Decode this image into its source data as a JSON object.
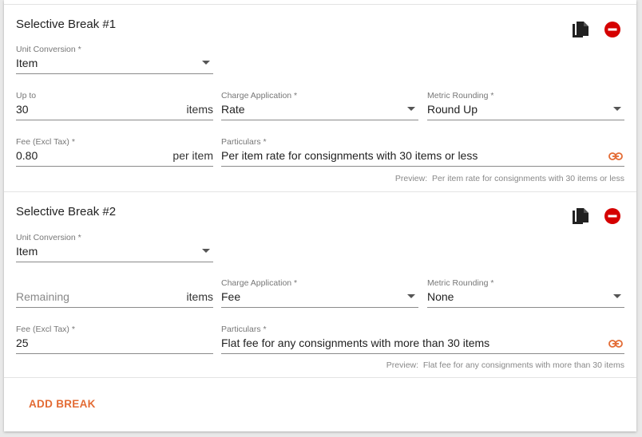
{
  "breaks": [
    {
      "title": "Selective Break #1",
      "unit_conversion": {
        "label": "Unit Conversion *",
        "value": "Item"
      },
      "range": {
        "label": "Up to",
        "value": "30",
        "suffix": "items"
      },
      "charge_application": {
        "label": "Charge Application *",
        "value": "Rate"
      },
      "metric_rounding": {
        "label": "Metric Rounding *",
        "value": "Round Up"
      },
      "fee": {
        "label": "Fee (Excl Tax) *",
        "value": "0.80",
        "suffix": "per item"
      },
      "particulars": {
        "label": "Particulars *",
        "value": "Per item rate for consignments with 30 items or less"
      },
      "preview_label": "Preview:",
      "preview_text": "Per item rate for consignments with 30 items or less"
    },
    {
      "title": "Selective Break #2",
      "unit_conversion": {
        "label": "Unit Conversion *",
        "value": "Item"
      },
      "range": {
        "label": "",
        "placeholder": "Remaining",
        "suffix": "items"
      },
      "charge_application": {
        "label": "Charge Application *",
        "value": "Fee"
      },
      "metric_rounding": {
        "label": "Metric Rounding *",
        "value": "None"
      },
      "fee": {
        "label": "Fee (Excl Tax) *",
        "value": "25",
        "suffix": ""
      },
      "particulars": {
        "label": "Particulars *",
        "value": "Flat fee for any consignments with more than 30 items"
      },
      "preview_label": "Preview:",
      "preview_text": "Flat fee for any consignments with more than 30 items"
    }
  ],
  "add_break_label": "ADD BREAK",
  "colors": {
    "accent": "#e36b34",
    "danger": "#d50000",
    "icon": "#212121"
  }
}
